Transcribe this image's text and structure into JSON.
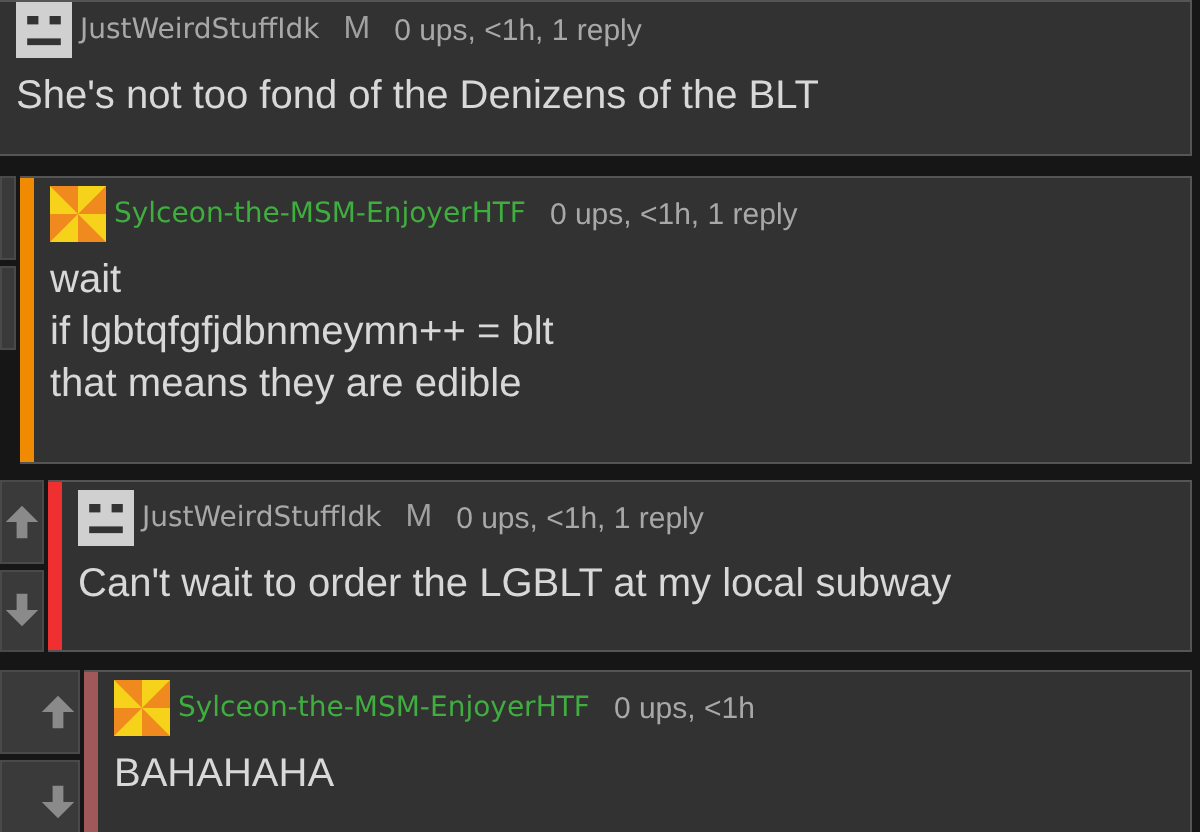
{
  "comments": [
    {
      "kind": "plain",
      "username": "JustWeirdStuffIdk",
      "badge": "M",
      "meta": "0 ups, <1h, 1 reply",
      "body": "She's not too fond of the Denizens of the BLT"
    },
    {
      "kind": "custom",
      "username": "Sylceon-the-MSM-EnjoyerHTF",
      "color": "#f08a00",
      "meta": "0 ups, <1h, 1 reply",
      "body": "wait\nif lgbtqfgfjdbnmeymn++ = blt\nthat means they are edible"
    },
    {
      "kind": "plain",
      "username": "JustWeirdStuffIdk",
      "color": "#f03030",
      "badge": "M",
      "meta": "0 ups, <1h, 1 reply",
      "body": "Can't wait to order the LGBLT at my local subway"
    },
    {
      "kind": "custom",
      "username": "Sylceon-the-MSM-EnjoyerHTF",
      "color": "#a05858",
      "meta": "0 ups, <1h",
      "body": "BAHAHAHA"
    }
  ]
}
